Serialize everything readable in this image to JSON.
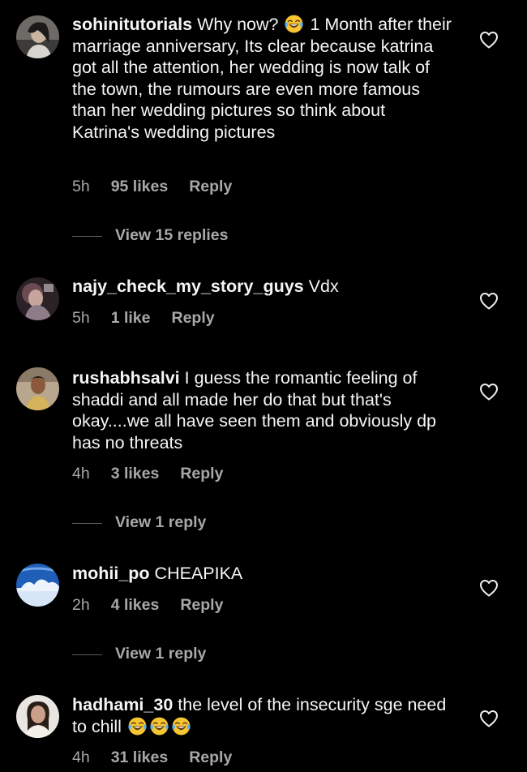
{
  "comments": [
    {
      "username": "sohinitutorials",
      "text_before_emoji": "Why now? ",
      "text_after_emoji": " 1 Month after their marriage anniversary, Its clear because katrina got all the attention, her wedding is now talk of the town, the rumours are even more famous than her wedding pictures so think about Katrina's wedding pictures",
      "emoji": "face-with-tears-of-joy",
      "time": "5h",
      "likes": "95 likes",
      "reply_label": "Reply",
      "view_replies": "View 15 replies"
    },
    {
      "username": "najy_check_my_story_guys",
      "text": "Vdx",
      "time": "5h",
      "likes": "1 like",
      "reply_label": "Reply"
    },
    {
      "username": "rushabhsalvi",
      "text": "I guess the romantic feeling of shaddi and all made her do that but that's okay....we all have seen them and obviously dp has no threats",
      "time": "4h",
      "likes": "3 likes",
      "reply_label": "Reply",
      "view_replies": "View 1 reply"
    },
    {
      "username": "mohii_po",
      "text": "CHEAPIKA",
      "time": "2h",
      "likes": "4 likes",
      "reply_label": "Reply",
      "view_replies": "View 1 reply"
    },
    {
      "username": "hadhami_30",
      "text": "the level of the insecurity sge need to chill ",
      "emoji": "face-with-tears-of-joy",
      "emoji_count": 3,
      "time": "4h",
      "likes": "31 likes",
      "reply_label": "Reply"
    }
  ],
  "icons": {
    "like": "heart-outline-icon",
    "emoji": "face-with-tears-of-joy"
  },
  "colors": {
    "background": "#000000",
    "text": "#f5f5f5",
    "secondary_text": "#a8a8a8",
    "emoji_face": "#f7c531"
  }
}
